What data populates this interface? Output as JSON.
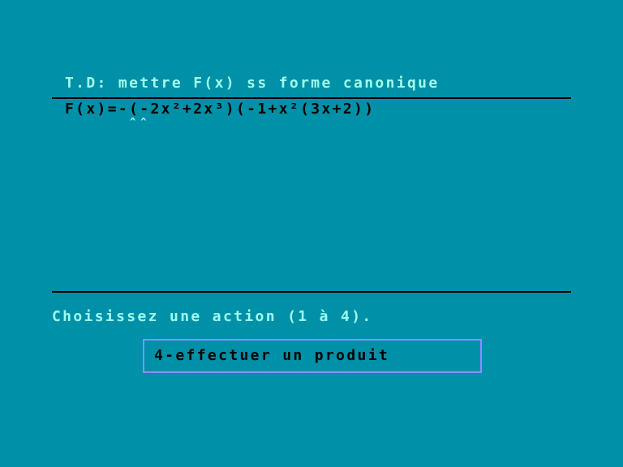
{
  "header": {
    "title": "T.D: mettre F(x) ss forme canonique"
  },
  "expression": {
    "formula": "F(x)=-(-2x²+2x³)(-1+x²(3x+2))",
    "cursor_markers": "^^"
  },
  "prompt": {
    "text": "Choisissez une action (1 à 4)."
  },
  "selection": {
    "current_option": "4-effectuer un produit"
  },
  "colors": {
    "background": "#0090a8",
    "text_cyan": "#a0fff0",
    "text_black": "#000000",
    "box_border": "#8c8cff"
  }
}
